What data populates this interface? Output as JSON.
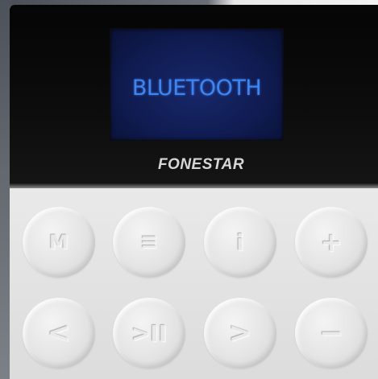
{
  "display": {
    "text": "BLUETOOTH",
    "text_color": "#3d86f2",
    "background_color": "#101c52"
  },
  "brand": {
    "name": "FONESTAR"
  },
  "buttons": [
    {
      "id": "mode",
      "label": "M",
      "icon": "mode-icon"
    },
    {
      "id": "menu",
      "label": "≡",
      "icon": "menu-icon"
    },
    {
      "id": "info",
      "label": "i",
      "icon": "info-icon"
    },
    {
      "id": "volume-up",
      "label": "+",
      "icon": "plus-icon"
    },
    {
      "id": "previous",
      "label": "<",
      "icon": "chevron-left-icon"
    },
    {
      "id": "play-pause",
      "label": ">II",
      "icon": "play-pause-icon"
    },
    {
      "id": "next",
      "label": ">",
      "icon": "chevron-right-icon"
    },
    {
      "id": "volume-down",
      "label": "−",
      "icon": "minus-icon"
    }
  ]
}
